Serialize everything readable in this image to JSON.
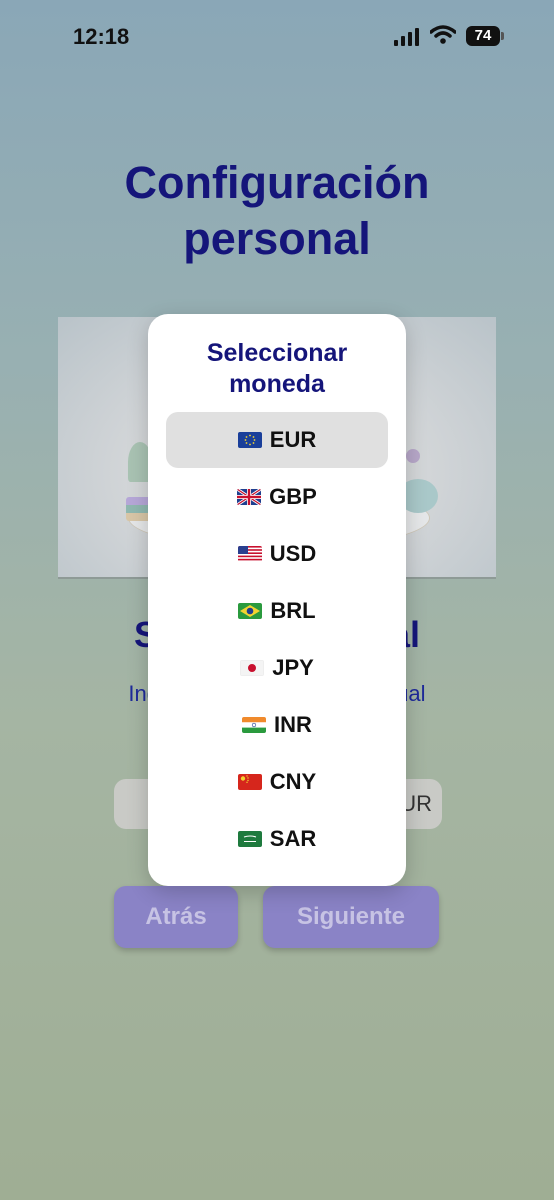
{
  "status_bar": {
    "time": "12:18",
    "battery": "74"
  },
  "page": {
    "title_line1": "Configuración",
    "title_line2": "personal",
    "section_title": "Sala              sual",
    "section_subtitle": "Ingresa                          ensual",
    "amount_suffix": "UR"
  },
  "buttons": {
    "back": "Atrás",
    "next": "Siguiente"
  },
  "modal": {
    "title_line1": "Seleccionar",
    "title_line2": "moneda",
    "options": [
      {
        "code": "EUR",
        "flag": "eu-flag-icon",
        "selected": true
      },
      {
        "code": "GBP",
        "flag": "uk-flag-icon"
      },
      {
        "code": "USD",
        "flag": "us-flag-icon"
      },
      {
        "code": "BRL",
        "flag": "brazil-flag-icon"
      },
      {
        "code": "JPY",
        "flag": "japan-flag-icon"
      },
      {
        "code": "INR",
        "flag": "india-flag-icon"
      },
      {
        "code": "CNY",
        "flag": "china-flag-icon"
      },
      {
        "code": "SAR",
        "flag": "saudi-flag-icon"
      }
    ]
  },
  "colors": {
    "title": "#15157a",
    "button": "#8a83c6",
    "selected_option": "#e0e0e0"
  }
}
